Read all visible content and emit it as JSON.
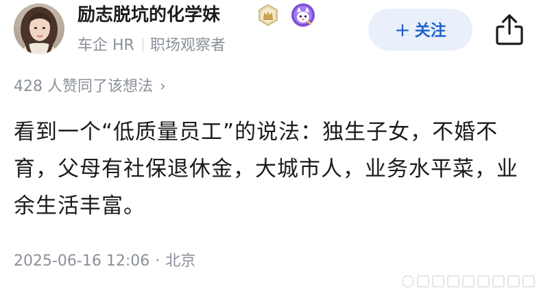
{
  "author": {
    "name": "励志脱坑的化学妹",
    "company": "车企 HR",
    "title": "职场观察者",
    "badges": [
      "crown-badge-icon",
      "character-badge-icon"
    ]
  },
  "actions": {
    "follow_plus": "+",
    "follow_label": "关注",
    "share_icon": "share-icon"
  },
  "post": {
    "likes_text": "428 人赞同了该想法",
    "likes_chevron": "›",
    "body": "看到一个“低质量员工”的说法：独生子女，不婚不育，父母有社保退休金，大城市人，业务水平菜，业余生活丰富。",
    "time": "2025-06-16 12:06",
    "dot": "·",
    "location": "北京"
  },
  "colors": {
    "accent": "#1f62d0",
    "follow_bg": "#eaf0fb",
    "muted": "#8a8f99",
    "text": "#1b1b1b"
  }
}
